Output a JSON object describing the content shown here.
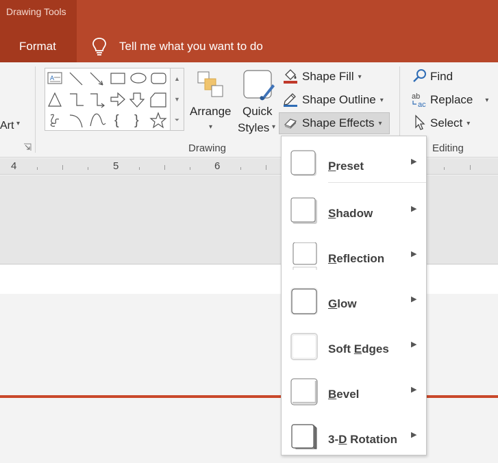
{
  "title_bar": {
    "context_title": "Drawing Tools",
    "tab": "Format",
    "tell_me": "Tell me what you want to do",
    "icons": [
      "lightbulb-icon"
    ]
  },
  "ribbon": {
    "wordart_fragment": "Art",
    "drawing": {
      "group_label": "Drawing",
      "arrange_label": "Arrange",
      "quick_styles_line1": "Quick",
      "quick_styles_line2": "Styles",
      "shape_fill": "Shape Fill",
      "shape_outline": "Shape Outline",
      "shape_effects": "Shape Effects"
    },
    "editing": {
      "group_label": "Editing",
      "find": "Find",
      "replace": "Replace",
      "select": "Select"
    }
  },
  "ruler": {
    "numbers": [
      "4",
      "5",
      "6"
    ]
  },
  "shape_effects_menu": {
    "items": [
      {
        "prefix": "",
        "accel": "P",
        "suffix": "reset",
        "has_submenu": true
      },
      {
        "prefix": "",
        "accel": "S",
        "suffix": "hadow",
        "has_submenu": true
      },
      {
        "prefix": "",
        "accel": "R",
        "suffix": "eflection",
        "has_submenu": true
      },
      {
        "prefix": "",
        "accel": "G",
        "suffix": "low",
        "has_submenu": true
      },
      {
        "prefix": "Soft ",
        "accel": "E",
        "suffix": "dges",
        "has_submenu": true
      },
      {
        "prefix": "",
        "accel": "B",
        "suffix": "evel",
        "has_submenu": true
      },
      {
        "prefix": "3-",
        "accel": "D",
        "suffix": " Rotation",
        "has_submenu": true
      }
    ]
  },
  "colors": {
    "title_bar": "#b7472a",
    "context_tab": "#a4391e",
    "accent_line": "#c9482a"
  }
}
